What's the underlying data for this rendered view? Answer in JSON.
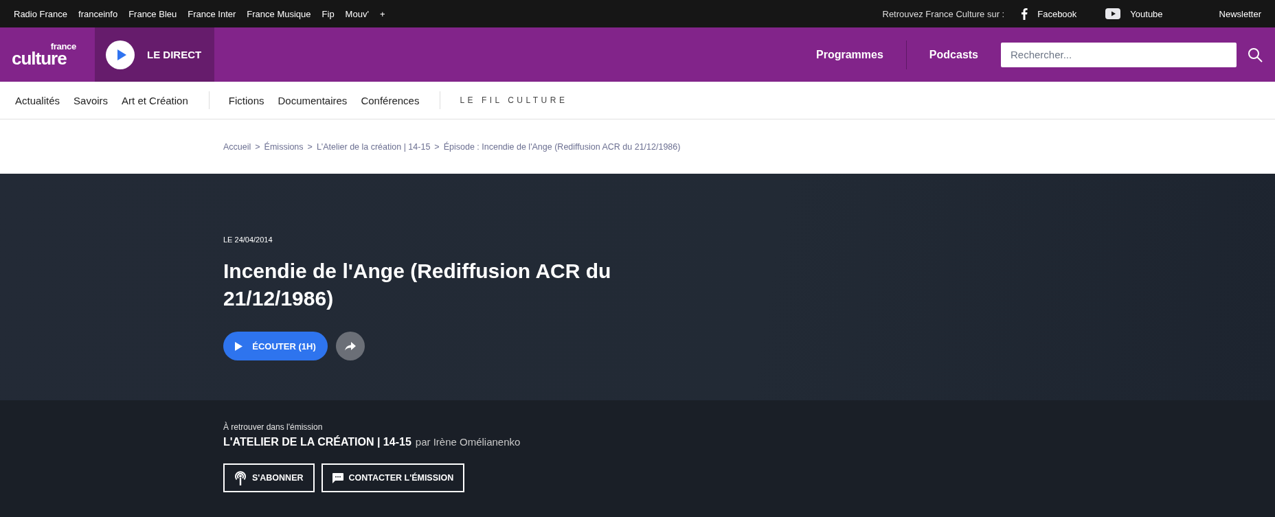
{
  "top_bar": {
    "stations": [
      "Radio France",
      "franceinfo",
      "France Bleu",
      "France Inter",
      "France Musique",
      "Fip",
      "Mouv'",
      "+"
    ],
    "follow_label": "Retrouvez France Culture sur :",
    "socials": [
      {
        "kind": "facebook",
        "label": "Facebook"
      },
      {
        "kind": "youtube",
        "label": "Youtube"
      }
    ],
    "newsletter": "Newsletter"
  },
  "header": {
    "logo_top": "france",
    "logo_bottom": "culture",
    "live_label": "LE DIRECT",
    "links": [
      "Programmes",
      "Podcasts"
    ],
    "search": {
      "placeholder": "Rechercher..."
    }
  },
  "nav": {
    "groups": [
      [
        "Actualités",
        "Savoirs",
        "Art et Création"
      ],
      [
        "Fictions",
        "Documentaires",
        "Conférences"
      ]
    ],
    "fil": "LE FIL CULTURE"
  },
  "breadcrumb": {
    "items": [
      "Accueil",
      "Émissions",
      "L'Atelier de la création | 14-15",
      "Épisode : Incendie de l'Ange (Rediffusion ACR du 21/12/1986)"
    ],
    "separators": [
      ">",
      ">",
      ">"
    ]
  },
  "episode": {
    "date": "LE 24/04/2014",
    "title": "Incendie de l'Ange (Rediffusion ACR du 21/12/1986)",
    "listen_button": "ÉCOUTER (1H)"
  },
  "show": {
    "intro": "À retrouver dans l'émission",
    "name": "L'ATELIER DE LA CRÉATION | 14-15",
    "by": "par Irène Omélianenko",
    "buttons": [
      {
        "kind": "subscribe",
        "label": "S'ABONNER"
      },
      {
        "kind": "contact",
        "label": "CONTACTER L'ÉMISSION"
      }
    ]
  }
}
